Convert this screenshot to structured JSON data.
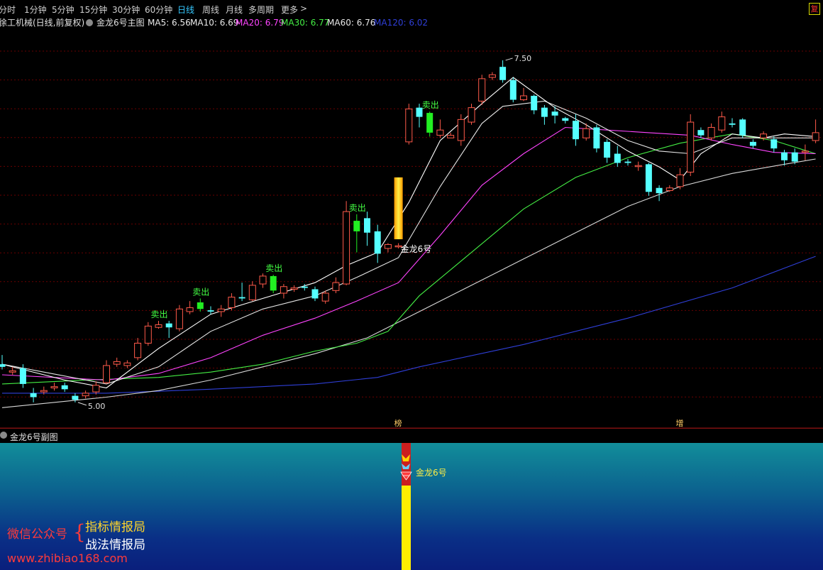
{
  "toolbar": {
    "periods": [
      "分时",
      "1分钟",
      "5分钟",
      "15分钟",
      "30分钟",
      "60分钟",
      "日线",
      "周线",
      "月线",
      "多周期",
      "更多"
    ],
    "active_period": "日线",
    "more_arrow": ">",
    "close_label": "复"
  },
  "main_header": {
    "stock": "徐工机械(日线,前复权)",
    "indicator": "金龙6号主图",
    "ma": [
      {
        "label": "MA5: 6.56",
        "color": "#e8e8e8"
      },
      {
        "label": "MA10: 6.69",
        "color": "#e8e8e8"
      },
      {
        "label": "MA20: 6.79",
        "color": "#ff44ff"
      },
      {
        "label": "MA30: 6.77",
        "color": "#44ee44"
      },
      {
        "label": "MA60: 6.76",
        "color": "#e8e8e8"
      },
      {
        "label": "MA120: 6.02",
        "color": "#2f3fd8"
      }
    ]
  },
  "chart_data": {
    "type": "candlestick",
    "ylim": [
      4.85,
      7.72
    ],
    "candles": [
      [
        5.2,
        5.18,
        5.27,
        5.16
      ],
      [
        5.14,
        5.15,
        5.18,
        5.12
      ],
      [
        5.17,
        5.05,
        5.2,
        5.02
      ],
      [
        4.98,
        4.95,
        5.02,
        4.91
      ],
      [
        4.99,
        5.0,
        5.03,
        4.97
      ],
      [
        5.02,
        5.03,
        5.06,
        5.0
      ],
      [
        5.04,
        5.01,
        5.06,
        4.99
      ],
      [
        4.96,
        4.93,
        4.98,
        4.91
      ],
      [
        4.96,
        4.98,
        5.0,
        4.94
      ],
      [
        4.99,
        5.04,
        5.07,
        4.97
      ],
      [
        5.06,
        5.19,
        5.23,
        5.05
      ],
      [
        5.2,
        5.22,
        5.25,
        5.18
      ],
      [
        5.19,
        5.21,
        5.23,
        5.17
      ],
      [
        5.25,
        5.36,
        5.4,
        5.23
      ],
      [
        5.36,
        5.49,
        5.52,
        5.34
      ],
      [
        5.48,
        5.5,
        5.53,
        5.47
      ],
      [
        5.51,
        5.48,
        5.53,
        5.4
      ],
      [
        5.47,
        5.62,
        5.65,
        5.45
      ],
      [
        5.6,
        5.63,
        5.68,
        5.58
      ],
      [
        5.67,
        5.62,
        5.7,
        5.6
      ],
      [
        5.61,
        5.6,
        5.64,
        5.58
      ],
      [
        5.6,
        5.62,
        5.65,
        5.56
      ],
      [
        5.63,
        5.71,
        5.74,
        5.61
      ],
      [
        5.71,
        5.7,
        5.82,
        5.68
      ],
      [
        5.69,
        5.8,
        5.83,
        5.68
      ],
      [
        5.81,
        5.87,
        5.89,
        5.78
      ],
      [
        5.87,
        5.76,
        5.88,
        5.74
      ],
      [
        5.74,
        5.79,
        5.81,
        5.7
      ],
      [
        5.77,
        5.78,
        5.8,
        5.75
      ],
      [
        5.79,
        5.78,
        5.81,
        5.76
      ],
      [
        5.77,
        5.7,
        5.79,
        5.68
      ],
      [
        5.68,
        5.74,
        5.76,
        5.66
      ],
      [
        5.76,
        5.82,
        5.86,
        5.74
      ],
      [
        5.81,
        6.36,
        6.44,
        5.8
      ],
      [
        6.29,
        6.21,
        6.34,
        6.05
      ],
      [
        6.31,
        6.2,
        6.36,
        6.1
      ],
      [
        6.21,
        6.04,
        6.26,
        5.97
      ],
      [
        6.08,
        6.11,
        6.12,
        6.05
      ],
      [
        6.1,
        6.1,
        6.12,
        6.08
      ],
      [
        6.89,
        7.14,
        7.18,
        6.87
      ],
      [
        7.15,
        7.08,
        7.18,
        7.0
      ],
      [
        7.11,
        6.96,
        7.12,
        6.93
      ],
      [
        6.94,
        6.98,
        7.06,
        6.92
      ],
      [
        6.92,
        6.94,
        6.96,
        6.92
      ],
      [
        6.9,
        7.06,
        7.1,
        6.86
      ],
      [
        7.04,
        7.15,
        7.18,
        7.02
      ],
      [
        7.2,
        7.37,
        7.4,
        7.17
      ],
      [
        7.38,
        7.4,
        7.42,
        7.36
      ],
      [
        7.46,
        7.36,
        7.51,
        7.34
      ],
      [
        7.36,
        7.21,
        7.38,
        7.19
      ],
      [
        7.21,
        7.24,
        7.3,
        7.2
      ],
      [
        7.24,
        7.13,
        7.25,
        7.1
      ],
      [
        7.15,
        7.08,
        7.17,
        7.02
      ],
      [
        7.12,
        7.09,
        7.16,
        7.03
      ],
      [
        7.07,
        7.05,
        7.08,
        7.03
      ],
      [
        7.05,
        6.91,
        7.1,
        6.86
      ],
      [
        6.92,
        6.99,
        7.03,
        6.9
      ],
      [
        7.0,
        6.84,
        7.02,
        6.81
      ],
      [
        6.89,
        6.77,
        6.91,
        6.73
      ],
      [
        6.8,
        6.73,
        6.86,
        6.7
      ],
      [
        6.74,
        6.73,
        6.76,
        6.71
      ],
      [
        6.71,
        6.71,
        6.74,
        6.67
      ],
      [
        6.72,
        6.51,
        6.73,
        6.48
      ],
      [
        6.54,
        6.5,
        6.56,
        6.44
      ],
      [
        6.52,
        6.54,
        6.56,
        6.51
      ],
      [
        6.55,
        6.64,
        6.69,
        6.53
      ],
      [
        6.66,
        7.04,
        7.1,
        6.63
      ],
      [
        6.98,
        6.94,
        7.0,
        6.92
      ],
      [
        6.92,
        7.0,
        7.03,
        6.9
      ],
      [
        6.98,
        7.08,
        7.12,
        6.96
      ],
      [
        7.03,
        7.02,
        7.07,
        7.0
      ],
      [
        7.06,
        6.94,
        7.07,
        6.92
      ],
      [
        6.89,
        6.86,
        6.91,
        6.84
      ],
      [
        6.92,
        6.95,
        6.97,
        6.9
      ],
      [
        6.91,
        6.84,
        6.93,
        6.81
      ],
      [
        6.81,
        6.75,
        6.83,
        6.71
      ],
      [
        6.81,
        6.74,
        6.84,
        6.72
      ],
      [
        6.82,
        6.82,
        6.87,
        6.75
      ],
      [
        6.9,
        6.96,
        7.06,
        6.88
      ]
    ],
    "ma5": [
      [
        0,
        5.2
      ],
      [
        6,
        5.08
      ],
      [
        10,
        5.02
      ],
      [
        15,
        5.32
      ],
      [
        20,
        5.58
      ],
      [
        25,
        5.7
      ],
      [
        30,
        5.82
      ],
      [
        33,
        5.95
      ],
      [
        36,
        6.05
      ],
      [
        39,
        6.43
      ],
      [
        42,
        6.9
      ],
      [
        46,
        7.18
      ],
      [
        49,
        7.38
      ],
      [
        53,
        7.15
      ],
      [
        56,
        7.02
      ],
      [
        60,
        6.82
      ],
      [
        63,
        6.7
      ],
      [
        65,
        6.6
      ],
      [
        67,
        6.8
      ],
      [
        70,
        6.95
      ],
      [
        73,
        6.92
      ],
      [
        75,
        6.95
      ],
      [
        78,
        6.93
      ]
    ],
    "ma10": [
      [
        0,
        5.2
      ],
      [
        10,
        5.05
      ],
      [
        15,
        5.18
      ],
      [
        20,
        5.45
      ],
      [
        25,
        5.62
      ],
      [
        30,
        5.72
      ],
      [
        34,
        5.86
      ],
      [
        38,
        6.01
      ],
      [
        42,
        6.55
      ],
      [
        46,
        7.03
      ],
      [
        48,
        7.16
      ],
      [
        52,
        7.2
      ],
      [
        56,
        7.07
      ],
      [
        60,
        6.9
      ],
      [
        63,
        6.82
      ],
      [
        66,
        6.8
      ],
      [
        70,
        6.92
      ],
      [
        74,
        6.92
      ],
      [
        78,
        6.92
      ]
    ],
    "ma20": [
      [
        0,
        5.12
      ],
      [
        10,
        5.08
      ],
      [
        15,
        5.13
      ],
      [
        20,
        5.25
      ],
      [
        25,
        5.42
      ],
      [
        30,
        5.55
      ],
      [
        34,
        5.68
      ],
      [
        38,
        5.82
      ],
      [
        42,
        6.18
      ],
      [
        46,
        6.56
      ],
      [
        50,
        6.8
      ],
      [
        54,
        7.0
      ],
      [
        58,
        6.98
      ],
      [
        62,
        6.96
      ],
      [
        66,
        6.94
      ],
      [
        70,
        6.87
      ],
      [
        74,
        6.81
      ],
      [
        78,
        6.8
      ]
    ],
    "ma30": [
      [
        0,
        5.05
      ],
      [
        8,
        5.08
      ],
      [
        15,
        5.1
      ],
      [
        20,
        5.14
      ],
      [
        25,
        5.2
      ],
      [
        30,
        5.3
      ],
      [
        34,
        5.36
      ],
      [
        37,
        5.45
      ],
      [
        40,
        5.72
      ],
      [
        45,
        6.05
      ],
      [
        50,
        6.38
      ],
      [
        55,
        6.62
      ],
      [
        60,
        6.77
      ],
      [
        65,
        6.88
      ],
      [
        70,
        6.95
      ],
      [
        74,
        6.9
      ],
      [
        78,
        6.8
      ]
    ],
    "ma60": [
      [
        0,
        4.87
      ],
      [
        10,
        4.95
      ],
      [
        15,
        5.0
      ],
      [
        20,
        5.08
      ],
      [
        25,
        5.18
      ],
      [
        30,
        5.28
      ],
      [
        35,
        5.4
      ],
      [
        40,
        5.6
      ],
      [
        45,
        5.8
      ],
      [
        50,
        6.0
      ],
      [
        55,
        6.2
      ],
      [
        60,
        6.4
      ],
      [
        65,
        6.55
      ],
      [
        70,
        6.65
      ],
      [
        75,
        6.72
      ],
      [
        78,
        6.76
      ]
    ],
    "ma120": [
      [
        0,
        4.98
      ],
      [
        10,
        4.98
      ],
      [
        20,
        5.01
      ],
      [
        30,
        5.05
      ],
      [
        36,
        5.1
      ],
      [
        40,
        5.18
      ],
      [
        50,
        5.35
      ],
      [
        60,
        5.55
      ],
      [
        70,
        5.78
      ],
      [
        78,
        6.02
      ]
    ],
    "signals": [
      {
        "index": 15,
        "label": "卖出"
      },
      {
        "index": 19,
        "label": "卖出"
      },
      {
        "index": 26,
        "label": "卖出"
      },
      {
        "index": 34,
        "label": "卖出"
      },
      {
        "index": 41,
        "label": "卖出"
      }
    ],
    "long_bar": {
      "index": 38,
      "top": 6.62,
      "bottom": 6.15
    },
    "long_bar_label": "金龙6号",
    "high_label": "7.50",
    "low_label": "5.00",
    "bottom_markers": [
      {
        "index": 38,
        "label": "榜"
      },
      {
        "index": 65,
        "label": "增"
      }
    ]
  },
  "sub_header": {
    "title": "金龙6号副图"
  },
  "sub_signal_label": "金龙6号",
  "watermark": {
    "left": "微信公众号",
    "brace": "{",
    "line1": "指标情报局",
    "line2": "战法情报局",
    "url": "www.zhibiao168.com"
  },
  "colors": {
    "up": "#ff5a4a",
    "down": "#55ffff",
    "signal_candle": "#22ee22",
    "signal_text": "#44ff44",
    "grid": "#6a0000",
    "panel_border": "#8a0f0f"
  }
}
